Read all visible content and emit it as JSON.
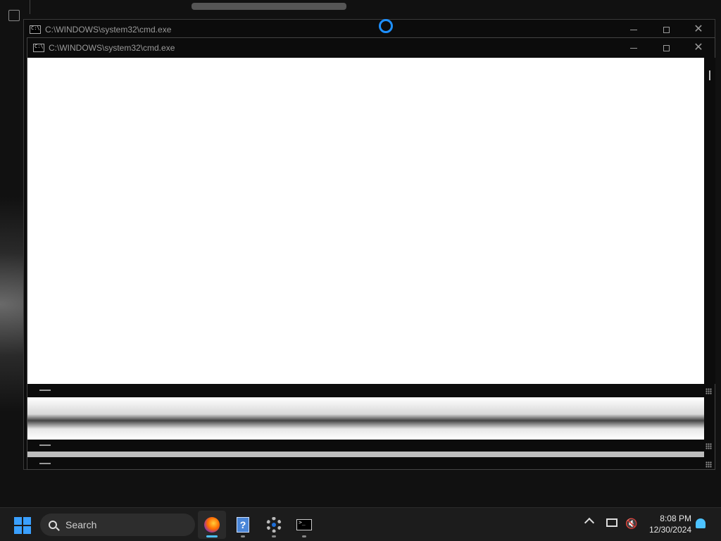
{
  "windows": {
    "back": {
      "title": "C:\\WINDOWS\\system32\\cmd.exe"
    },
    "front": {
      "title": "C:\\WINDOWS\\system32\\cmd.exe"
    }
  },
  "taskbar": {
    "search_label": "Search",
    "apps": [
      "firefox-icon",
      "help-icon",
      "settings-icon",
      "cmd-icon"
    ],
    "active_app": "firefox-icon",
    "time": "8:08 PM",
    "date": "12/30/2024"
  },
  "colors": {
    "accent": "#4cc2ff",
    "start": "#3aa0ff"
  }
}
